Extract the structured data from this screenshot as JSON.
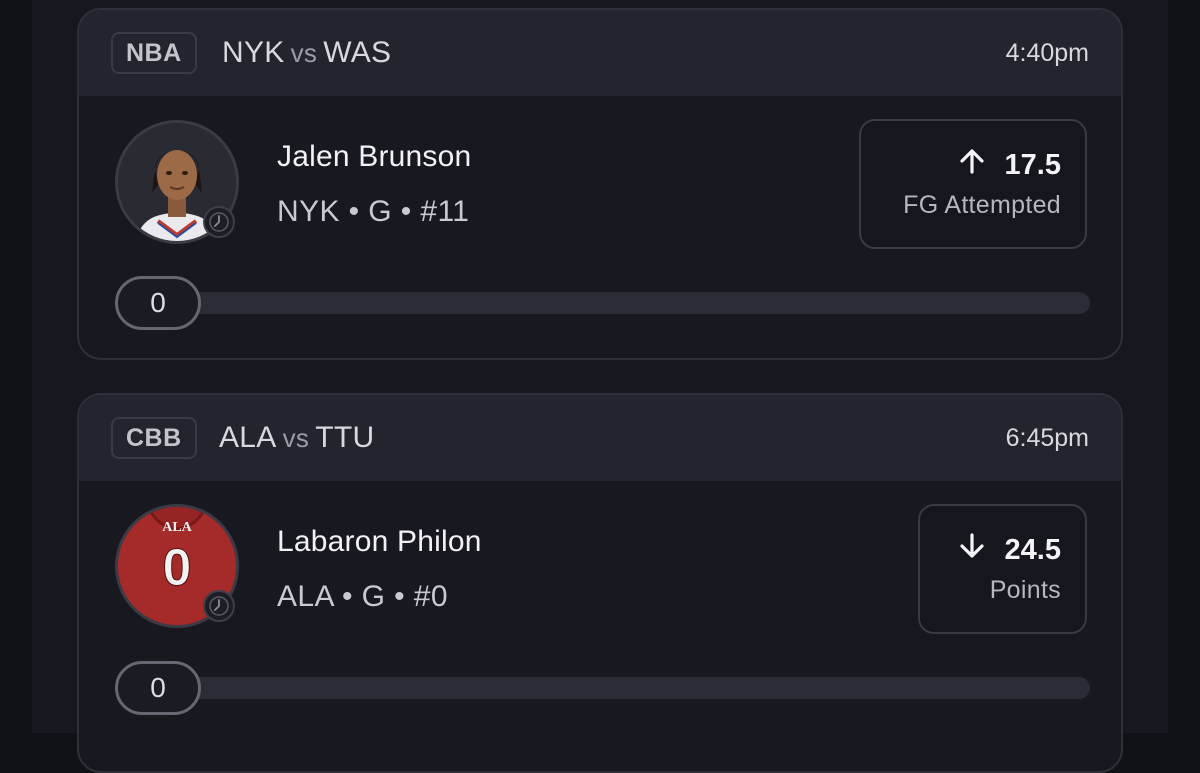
{
  "cards": [
    {
      "league": "NBA",
      "home_team": "NYK",
      "vs": "vs",
      "away_team": "WAS",
      "time": "4:40pm",
      "player": {
        "name": "Jalen Brunson",
        "meta": "NYK • G • #11"
      },
      "prop": {
        "direction_icon": "arrow-up-icon",
        "line": "17.5",
        "stat": "FG Attempted"
      },
      "progress": {
        "value": "0",
        "fraction": 0
      }
    },
    {
      "league": "CBB",
      "home_team": "ALA",
      "vs": "vs",
      "away_team": "TTU",
      "time": "6:45pm",
      "player": {
        "name": "Labaron Philon",
        "meta": "ALA • G • #0",
        "jersey_text": "ALA",
        "jersey_number": "0"
      },
      "prop": {
        "direction_icon": "arrow-down-icon",
        "line": "24.5",
        "stat": "Points"
      },
      "progress": {
        "value": "0",
        "fraction": 0
      }
    }
  ]
}
